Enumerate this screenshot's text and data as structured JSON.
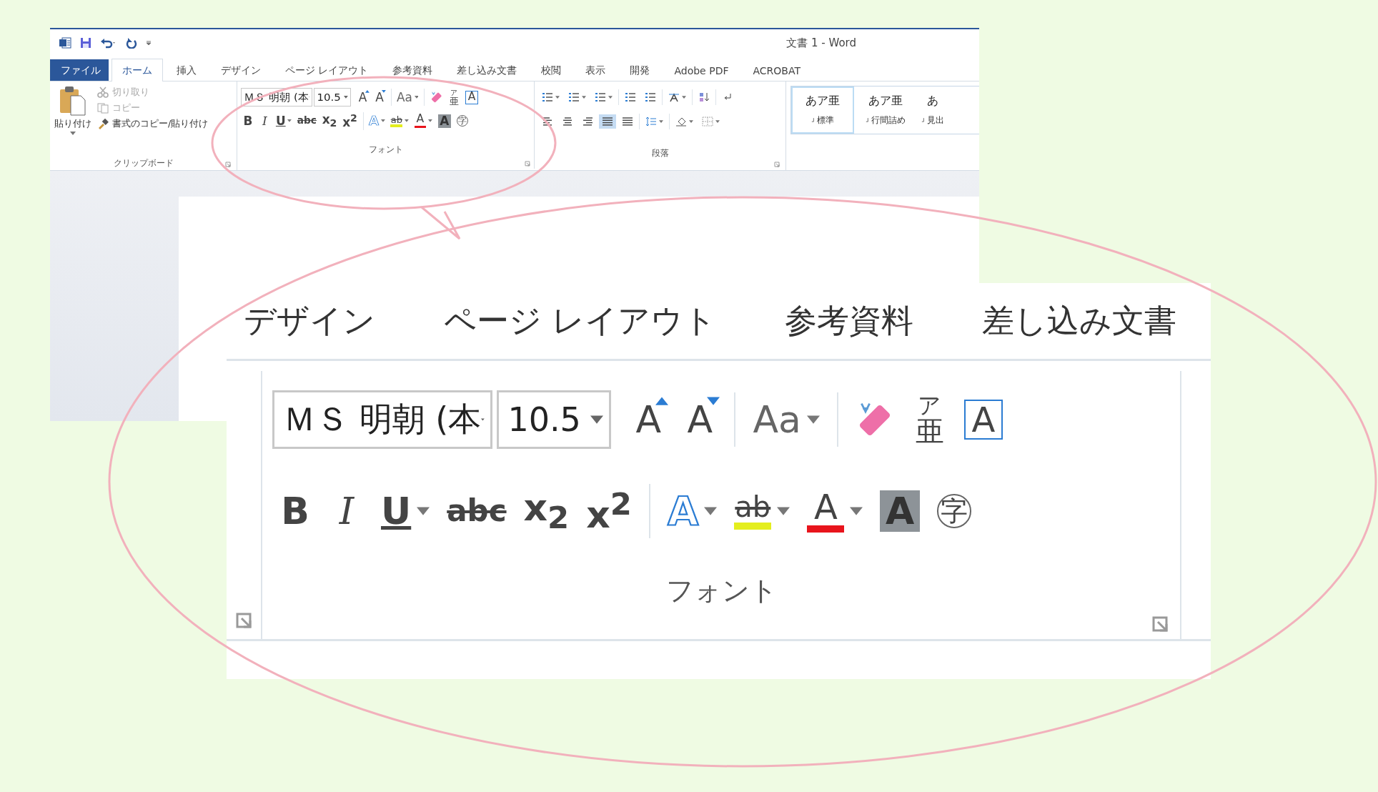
{
  "window": {
    "title": "文書 1 - Word",
    "tabs": [
      {
        "label": "ファイル",
        "kind": "file",
        "selected": false
      },
      {
        "label": "ホーム",
        "kind": "tab",
        "selected": true
      },
      {
        "label": "挿入",
        "kind": "tab",
        "selected": false
      },
      {
        "label": "デザイン",
        "kind": "tab",
        "selected": false
      },
      {
        "label": "ページ レイアウト",
        "kind": "tab",
        "selected": false
      },
      {
        "label": "参考資料",
        "kind": "tab",
        "selected": false
      },
      {
        "label": "差し込み文書",
        "kind": "tab",
        "selected": false
      },
      {
        "label": "校閲",
        "kind": "tab",
        "selected": false
      },
      {
        "label": "表示",
        "kind": "tab",
        "selected": false
      },
      {
        "label": "開発",
        "kind": "tab",
        "selected": false
      },
      {
        "label": "Adobe PDF",
        "kind": "tab",
        "selected": false
      },
      {
        "label": "ACROBAT",
        "kind": "tab",
        "selected": false
      }
    ],
    "clipboard": {
      "paste": "貼り付け",
      "label": "クリップボード",
      "actions": [
        {
          "label": "切り取り",
          "kind": "cut",
          "disabled": true
        },
        {
          "label": "コピー",
          "kind": "copy",
          "disabled": true
        },
        {
          "label": "書式のコピー/貼り付け",
          "kind": "painter",
          "disabled": false
        }
      ]
    },
    "font": {
      "name": "ＭＳ 明朝 (本",
      "size": "10.5",
      "label": "フォント",
      "row1": [
        {
          "kind": "grow",
          "glyph": "A"
        },
        {
          "kind": "shrink",
          "glyph": "A"
        },
        {
          "kind": "case",
          "glyph": "Aa",
          "dropdown": true
        },
        {
          "kind": "clear"
        },
        {
          "kind": "ruby",
          "top": "ア",
          "glyph": "亜"
        },
        {
          "kind": "boxed",
          "glyph": "A"
        }
      ],
      "row2": [
        {
          "kind": "bold",
          "glyph": "B"
        },
        {
          "kind": "italic",
          "glyph": "I"
        },
        {
          "kind": "underline",
          "glyph": "U",
          "dropdown": true
        },
        {
          "kind": "strike",
          "glyph": "abc"
        },
        {
          "kind": "sub",
          "glyph": "x$_{2}$"
        },
        {
          "kind": "sup",
          "glyph": "x$^{2}$"
        },
        {
          "kind": "effect",
          "glyph": "A",
          "dropdown": true
        },
        {
          "kind": "highlight",
          "glyph": "ab",
          "color": "#e4ee1e",
          "dropdown": true
        },
        {
          "kind": "color",
          "glyph": "A",
          "color": "#e8141c",
          "dropdown": true
        },
        {
          "kind": "shading",
          "glyph": "A"
        },
        {
          "kind": "enclose",
          "glyph": "字"
        }
      ]
    },
    "paragraph": {
      "label": "段落",
      "row1": [
        {
          "kind": "bullets",
          "dropdown": true
        },
        {
          "kind": "numbering",
          "dropdown": true
        },
        {
          "kind": "multilevel",
          "dropdown": true
        },
        {
          "kind": "outdent",
          "dropdown": false
        },
        {
          "kind": "indent",
          "dropdown": false
        },
        {
          "kind": "direction",
          "dropdown": true
        },
        {
          "kind": "sort",
          "dropdown": false
        },
        {
          "kind": "marks",
          "dropdown": false
        }
      ],
      "row2": [
        {
          "kind": "left",
          "dropdown": false,
          "selected": false
        },
        {
          "kind": "center",
          "dropdown": false,
          "selected": false
        },
        {
          "kind": "right",
          "dropdown": false,
          "selected": false
        },
        {
          "kind": "justify",
          "dropdown": false,
          "selected": true
        },
        {
          "kind": "distribute",
          "dropdown": false,
          "selected": false
        },
        {
          "kind": "spacing",
          "dropdown": true,
          "selected": false
        },
        {
          "kind": "fill",
          "dropdown": true,
          "selected": false
        },
        {
          "kind": "borders",
          "dropdown": true,
          "selected": false
        }
      ]
    },
    "styles": [
      {
        "sample": "あア亜",
        "label": "標準",
        "selected": true
      },
      {
        "sample": "あア亜",
        "label": "行間詰め",
        "selected": false
      },
      {
        "sample": "あ",
        "label": "見出",
        "selected": false
      }
    ]
  },
  "zoom": {
    "tabs": [
      "デザイン",
      "ページ レイアウト",
      "参考資料",
      "差し込み文書"
    ],
    "font": {
      "name": "ＭＳ 明朝 (本",
      "size": "10.5",
      "label": "フォント",
      "row1": [
        {
          "kind": "grow",
          "glyph": "A"
        },
        {
          "kind": "shrink",
          "glyph": "A"
        },
        {
          "kind": "case",
          "glyph": "Aa",
          "dropdown": true
        },
        {
          "kind": "clear"
        },
        {
          "kind": "ruby",
          "top": "ア",
          "glyph": "亜"
        },
        {
          "kind": "boxed",
          "glyph": "A"
        }
      ],
      "row2": [
        {
          "kind": "bold",
          "glyph": "B"
        },
        {
          "kind": "italic",
          "glyph": "I"
        },
        {
          "kind": "underline",
          "glyph": "U",
          "dropdown": true
        },
        {
          "kind": "strike",
          "glyph": "abc"
        },
        {
          "kind": "sub",
          "glyph": "x$_{2}$"
        },
        {
          "kind": "sup",
          "glyph": "x$^{2}$"
        },
        {
          "kind": "effect",
          "glyph": "A",
          "dropdown": true
        },
        {
          "kind": "highlight",
          "glyph": "ab",
          "color": "#e4ee1e",
          "dropdown": true
        },
        {
          "kind": "color",
          "glyph": "A",
          "color": "#e8141c",
          "dropdown": true
        },
        {
          "kind": "shading",
          "glyph": "A"
        },
        {
          "kind": "enclose",
          "glyph": "字"
        }
      ]
    }
  }
}
